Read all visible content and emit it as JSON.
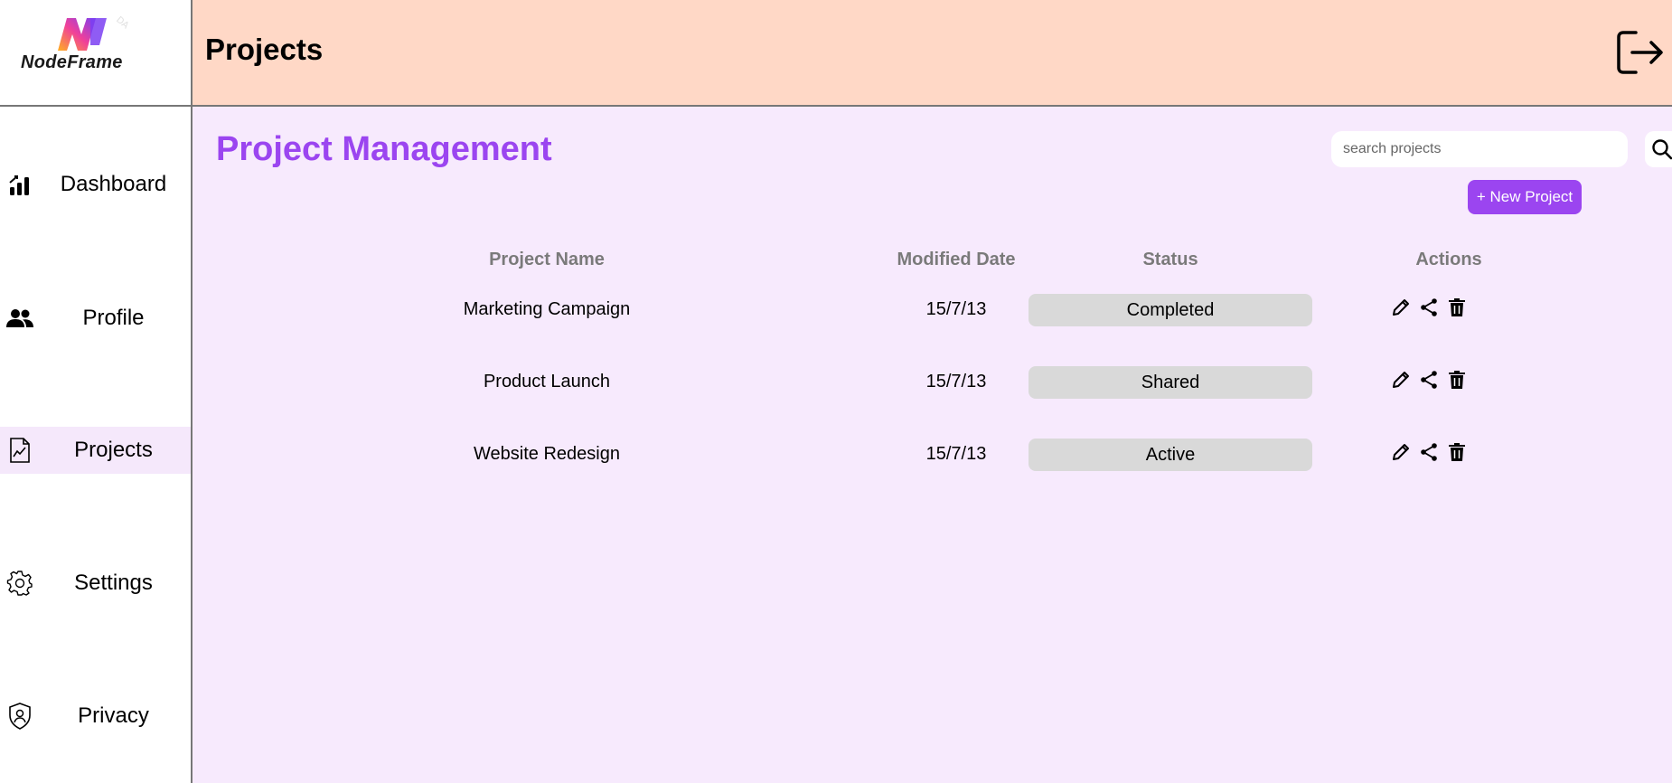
{
  "brand": {
    "name": "NodeFrame",
    "watermark": "DA"
  },
  "sidebar": {
    "items": [
      {
        "label": "Dashboard",
        "icon": "bar-chart-icon",
        "active": false
      },
      {
        "label": "Profile",
        "icon": "people-icon",
        "active": false
      },
      {
        "label": "Projects",
        "icon": "document-chart-icon",
        "active": true
      },
      {
        "label": "Settings",
        "icon": "gear-icon",
        "active": false
      },
      {
        "label": "Privacy",
        "icon": "shield-user-icon",
        "active": false
      }
    ]
  },
  "header": {
    "title": "Projects",
    "logout_icon": "logout-icon"
  },
  "main": {
    "title": "Project Management",
    "search": {
      "placeholder": "search projects",
      "value": ""
    },
    "new_project_label": "+ New Project",
    "table": {
      "headers": [
        "Project Name",
        "Modified Date",
        "Status",
        "Actions"
      ],
      "rows": [
        {
          "name": "Marketing Campaign",
          "date": "15/7/13",
          "status": "Completed"
        },
        {
          "name": "Product Launch",
          "date": "15/7/13",
          "status": "Shared"
        },
        {
          "name": "Website Redesign",
          "date": "15/7/13",
          "status": "Active"
        }
      ]
    }
  },
  "colors": {
    "accent": "#9b45f0",
    "header_bg": "#ffd8c6",
    "main_bg": "#f7eafd",
    "active_nav_bg": "#f5e8fb",
    "badge_bg": "#d9d9d9"
  }
}
